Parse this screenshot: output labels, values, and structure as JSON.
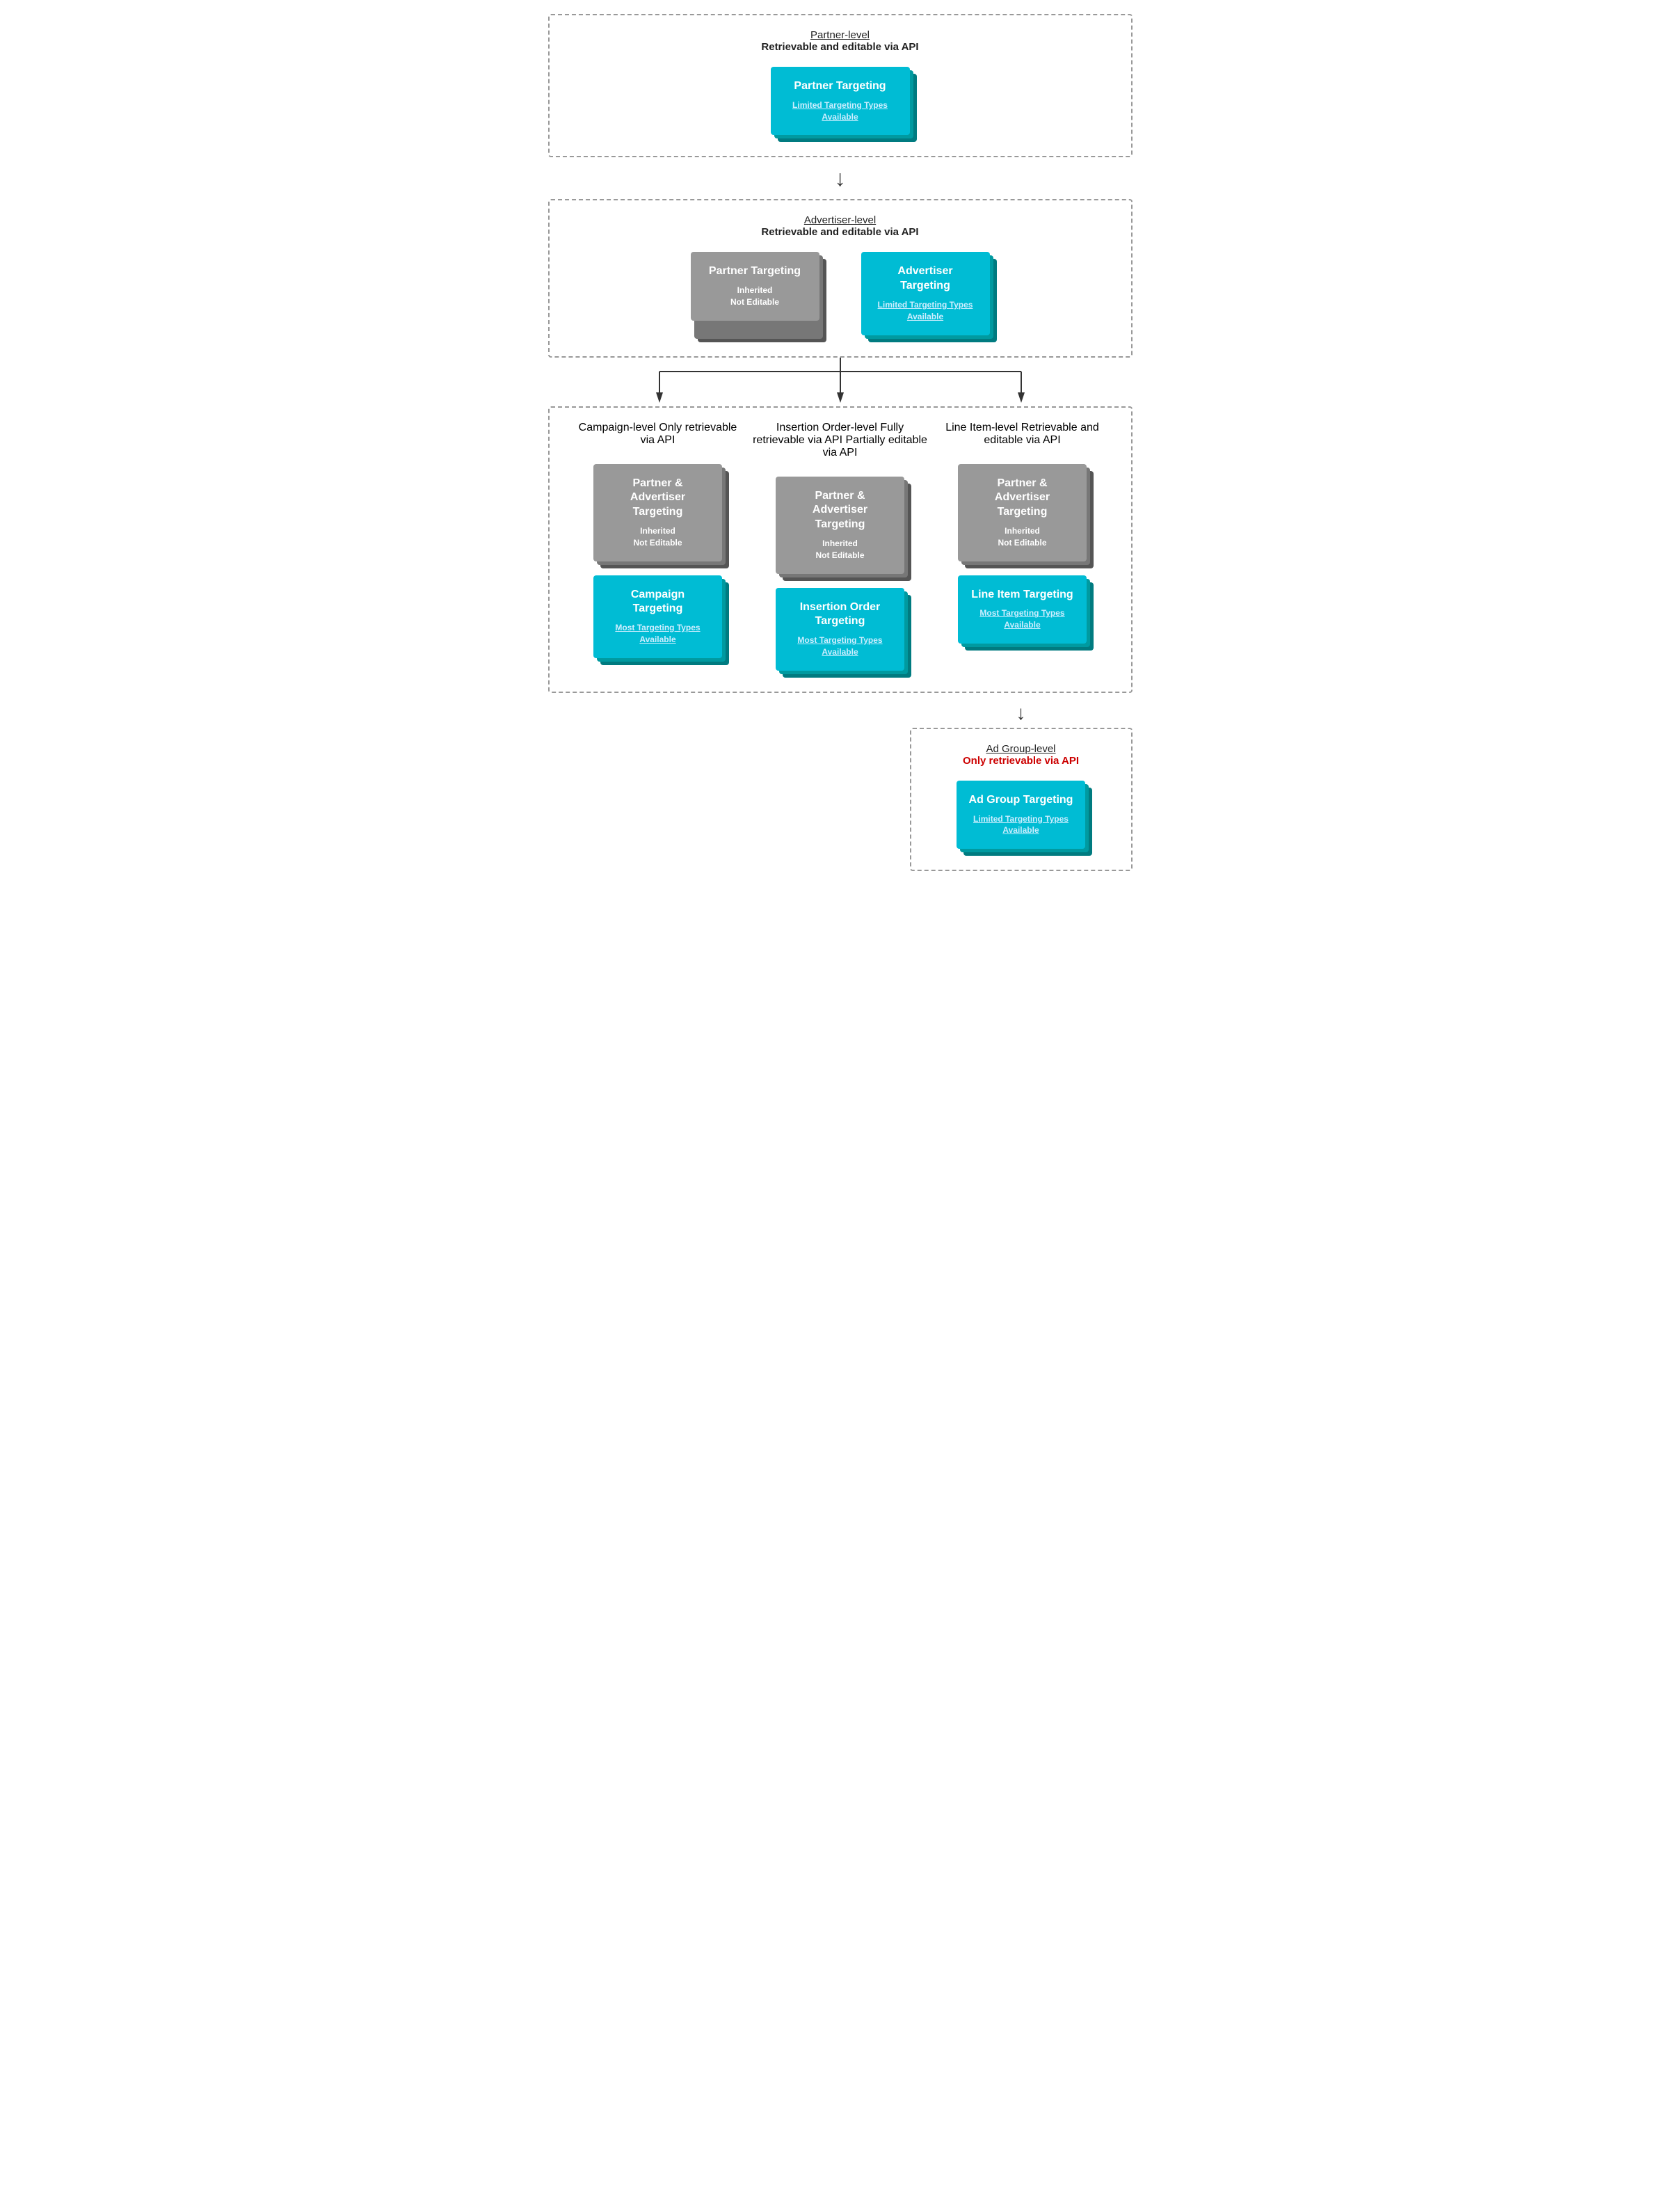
{
  "levels": {
    "partner": {
      "name": "Partner-level",
      "desc": "Retrievable and editable via API",
      "desc_color": "black"
    },
    "advertiser": {
      "name": "Advertiser-level",
      "desc": "Retrievable and editable via API",
      "desc_color": "black"
    },
    "campaign": {
      "name": "Campaign-level",
      "desc_line1": "Only retrievable via API",
      "desc_color": "red"
    },
    "insertion_order": {
      "name": "Insertion Order-level",
      "desc_line1": "Fully retrievable via API",
      "desc_line2": "Partially editable via API",
      "desc_color": "red"
    },
    "line_item": {
      "name": "Line Item-level",
      "desc": "Retrievable and editable via API",
      "desc_color": "black"
    },
    "ad_group": {
      "name": "Ad Group-level",
      "desc_line1": "Only retrievable via API",
      "desc_color": "red"
    }
  },
  "cards": {
    "partner_targeting": {
      "title": "Partner Targeting",
      "link": "Limited Targeting Types Available",
      "type": "teal"
    },
    "partner_targeting_inherited": {
      "title": "Partner Targeting",
      "subtitle_line1": "Inherited",
      "subtitle_line2": "Not Editable",
      "type": "gray"
    },
    "advertiser_targeting": {
      "title": "Advertiser Targeting",
      "link": "Limited Targeting Types Available",
      "type": "teal"
    },
    "partner_advertiser_targeting_inherited": {
      "title": "Partner & Advertiser Targeting",
      "subtitle_line1": "Inherited",
      "subtitle_line2": "Not Editable",
      "type": "gray"
    },
    "campaign_targeting": {
      "title": "Campaign Targeting",
      "link": "Most Targeting Types Available",
      "type": "teal"
    },
    "insertion_order_targeting": {
      "title": "Insertion Order Targeting",
      "link": "Most Targeting Types Available",
      "type": "teal"
    },
    "line_item_targeting": {
      "title": "Line Item Targeting",
      "link": "Most Targeting Types Available",
      "type": "teal"
    },
    "ad_group_targeting": {
      "title": "Ad Group Targeting",
      "link": "Limited Targeting Types Available",
      "type": "teal"
    }
  }
}
